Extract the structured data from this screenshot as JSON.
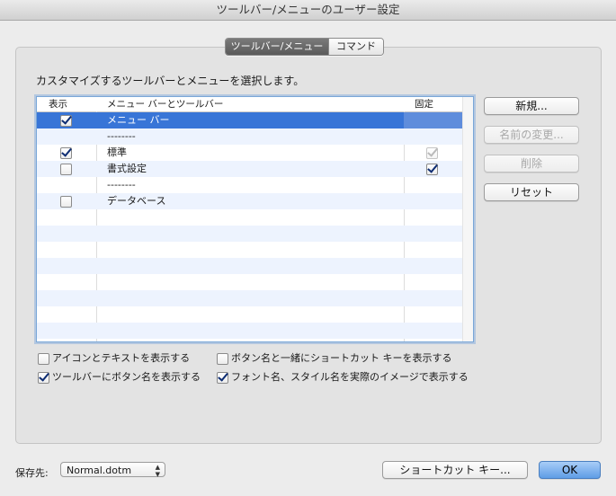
{
  "window": {
    "title": "ツールバー/メニューのユーザー設定"
  },
  "tabs": [
    {
      "label": "ツールバー/メニュー",
      "active": true
    },
    {
      "label": "コマンド",
      "active": false
    }
  ],
  "instruction": "カスタマイズするツールバーとメニューを選択します。",
  "table": {
    "columns": [
      "表示",
      "メニュー バーとツールバー",
      "固定"
    ],
    "rows": [
      {
        "show": true,
        "name": "メニュー バー",
        "fixed": null,
        "selected": true
      },
      {
        "show": null,
        "name": "--------",
        "fixed": null
      },
      {
        "show": true,
        "name": "標準",
        "fixed": true,
        "fixed_disabled": true
      },
      {
        "show": false,
        "name": "書式設定",
        "fixed": true
      },
      {
        "show": null,
        "name": "--------",
        "fixed": null
      },
      {
        "show": false,
        "name": "データベース",
        "fixed": null
      }
    ]
  },
  "buttons": {
    "new": "新規...",
    "rename": "名前の変更...",
    "delete": "削除",
    "reset": "リセット",
    "shortcut": "ショートカット キー...",
    "ok": "OK"
  },
  "options": [
    {
      "label": "アイコンとテキストを表示する",
      "checked": false
    },
    {
      "label": "ボタン名と一緒にショートカット キーを表示する",
      "checked": false
    },
    {
      "label": "ツールバーにボタン名を表示する",
      "checked": true
    },
    {
      "label": "フォント名、スタイル名を実際のイメージで表示する",
      "checked": true
    }
  ],
  "save": {
    "label": "保存先:",
    "value": "Normal.dotm"
  },
  "colors": {
    "selection": "#3875d7",
    "ok_button": "#5f9de6"
  }
}
